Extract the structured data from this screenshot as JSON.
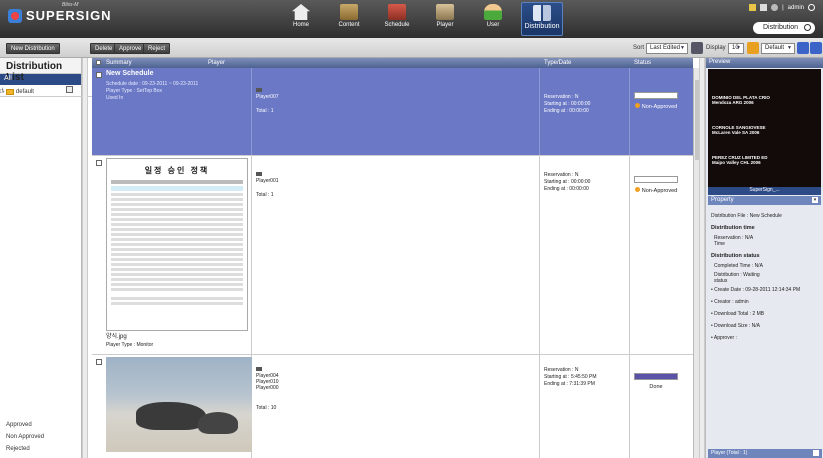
{
  "app": {
    "brand": "SUPERSIGN",
    "brand_sub": "Bliss-M"
  },
  "nav": [
    {
      "label": "Home",
      "icon": "home-icon"
    },
    {
      "label": "Content",
      "icon": "content-icon"
    },
    {
      "label": "Schedule",
      "icon": "schedule-icon"
    },
    {
      "label": "Player",
      "icon": "player-icon"
    },
    {
      "label": "User",
      "icon": "user-icon"
    },
    {
      "label": "Distribution",
      "icon": "distribution-icon",
      "active": true
    }
  ],
  "topright": {
    "admin": "admin",
    "search_value": "Distribution"
  },
  "toolbar": {
    "new_distribution": "New Distribution",
    "delete": "Delete",
    "approve": "Approve",
    "reject": "Reject",
    "sort_label": "Sort",
    "sort_value": "Last Edited",
    "display_label": "Display",
    "display_value": "10",
    "theme_value": "Default"
  },
  "left": {
    "title": "Distribution List",
    "all": "All",
    "tree_root": "□",
    "tree_child": "default",
    "status": [
      "Approved",
      "Non Approved",
      "Rejected"
    ]
  },
  "table": {
    "headers": {
      "summary": "Summary",
      "player": "Player",
      "typedate": "Type/Date",
      "status": "Status"
    },
    "rows": [
      {
        "title": "New Schedule",
        "line1": "Schedule date : 09-23-2011 ~ 09-23-2011",
        "line2": "Player Type : SetTop Box",
        "line3": "Used In",
        "players": [
          "Player007"
        ],
        "total": "Total : 1",
        "reservation": "Reservation : N",
        "starting": "Starting at    : 00:00:00",
        "ending": "Ending at      : 00:00:00",
        "status": "Non-Approved"
      },
      {
        "doc_title": "일정 승인 정책",
        "filename": "양식.jpg",
        "player_type": "Player Type : Monitor",
        "players": [
          "Player001"
        ],
        "total": "Total : 1",
        "reservation": "Reservation : N",
        "starting": "Starting at    : 00:00:00",
        "ending": "Ending at      : 00:00:00",
        "status": "Non-Approved"
      },
      {
        "players": [
          "Player004",
          "Player010",
          "Player000"
        ],
        "total": "Total : 10",
        "reservation": "Reservation : N",
        "starting": "Starting at    : 5:45:50 PM",
        "ending": "Ending at      : 7:31:39 PM",
        "status": "Done",
        "progress": 1.0
      }
    ]
  },
  "preview": {
    "header": "Preview",
    "slide_lines": [
      "DOMINIO DEL PLATA CRIO",
      "Mendoza ARG 2006",
      "CORNOLE SANGIOVESE",
      "McLaren Vale SA 2006",
      "PEREZ CRUZ LIMITED ED",
      "Maipo Valley CHL 2006"
    ],
    "caption": "SuperSign_...",
    "property_header": "Property",
    "distribution_file": "Distribution File : New Schedule",
    "section_time": "Distribution time",
    "reservation_time": "Reservation   : N/A",
    "reservation_time2": "Time",
    "section_status": "Distribution status",
    "completed": "Completed Time : N/A",
    "distribution_status": "Distribution    : Waiting",
    "distribution_status2": "status",
    "create_date": "• Create Date     :  09-28-2011 12:14:34 PM",
    "creator": "• Creator          :  admin",
    "download_total": "• Download Total  :  2 MB",
    "download_size": "• Download Size   :  N/A",
    "approver": "• Approver         :",
    "footer": "Player (Total : 1)"
  }
}
